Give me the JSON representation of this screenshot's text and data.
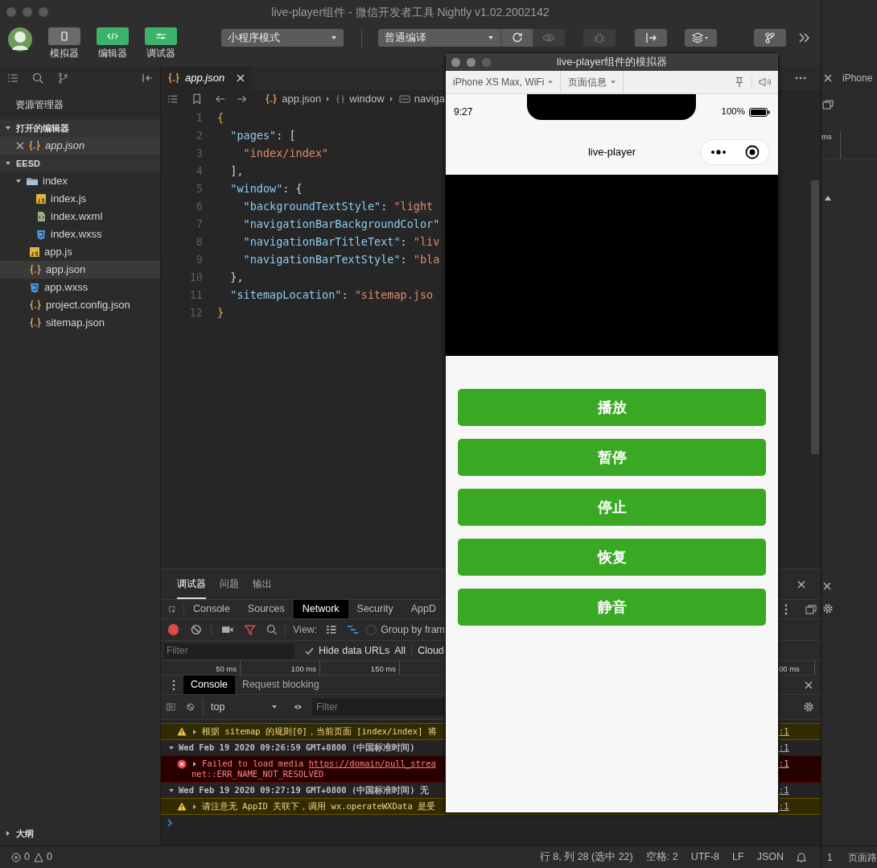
{
  "window": {
    "title": "live-player组件 - 微信开发者工具 Nightly v1.02.2002142"
  },
  "toolbar": {
    "view_toggles": [
      {
        "label": "模拟器",
        "on": false
      },
      {
        "label": "编辑器",
        "on": true
      },
      {
        "label": "调试器",
        "on": true
      }
    ],
    "mode": "小程序模式",
    "compile": "普通编译",
    "actions": [
      {
        "kind": "refresh",
        "disabled": false
      },
      {
        "kind": "preview",
        "disabled": true
      },
      {
        "kind": "debug",
        "disabled": true
      },
      {
        "kind": "background",
        "disabled": false
      },
      {
        "kind": "layers",
        "disabled": false
      },
      {
        "kind": "version",
        "disabled": false
      }
    ]
  },
  "sidebar": {
    "title": "资源管理器",
    "sections": [
      {
        "label": "打开的编辑器",
        "expanded": true,
        "items": [
          {
            "name": "app.json",
            "kind": "json",
            "selected": true,
            "closable": true
          }
        ]
      },
      {
        "label": "EESD",
        "expanded": true,
        "items": [
          {
            "name": "index",
            "kind": "folder",
            "selected": false,
            "expanded": true,
            "children": [
              {
                "name": "index.js",
                "kind": "js",
                "selected": false
              },
              {
                "name": "index.wxml",
                "kind": "wxml",
                "selected": false
              },
              {
                "name": "index.wxss",
                "kind": "wxss",
                "selected": false
              }
            ]
          },
          {
            "name": "app.js",
            "kind": "js",
            "selected": false
          },
          {
            "name": "app.json",
            "kind": "json",
            "selected": true
          },
          {
            "name": "app.wxss",
            "kind": "wxss",
            "selected": false
          },
          {
            "name": "project.config.json",
            "kind": "json",
            "selected": false
          },
          {
            "name": "sitemap.json",
            "kind": "json",
            "selected": false
          }
        ]
      },
      {
        "label": "大纲",
        "expanded": false
      }
    ]
  },
  "editor": {
    "tabs": [
      {
        "label": "app.json",
        "selected": true
      }
    ],
    "breadcrumb": [
      {
        "kind": "json",
        "label": "app.json"
      },
      {
        "kind": "object",
        "label": "window"
      },
      {
        "kind": "string",
        "label": "naviga"
      }
    ],
    "lines": [
      {
        "number": "1",
        "tokens": [
          {
            "kind": "brace",
            "text": "{"
          }
        ]
      },
      {
        "number": "2",
        "tokens": [
          {
            "kind": "key",
            "text": "  \"pages\""
          },
          {
            "kind": "punct",
            "text": ": ["
          }
        ]
      },
      {
        "number": "3",
        "tokens": [
          {
            "kind": "string",
            "text": "    \"index/index\""
          }
        ]
      },
      {
        "number": "4",
        "tokens": [
          {
            "kind": "punct",
            "text": "  ],"
          }
        ]
      },
      {
        "number": "5",
        "tokens": [
          {
            "kind": "key",
            "text": "  \"window\""
          },
          {
            "kind": "punct",
            "text": ": {"
          }
        ]
      },
      {
        "number": "6",
        "tokens": [
          {
            "kind": "key",
            "text": "    \"backgroundTextStyle\""
          },
          {
            "kind": "punct",
            "text": ": "
          },
          {
            "kind": "string",
            "text": "\"light"
          }
        ]
      },
      {
        "number": "7",
        "tokens": [
          {
            "kind": "key",
            "text": "    \"navigationBarBackgroundColor\""
          }
        ]
      },
      {
        "number": "8",
        "tokens": [
          {
            "kind": "key",
            "text": "    \"navigationBarTitleText\""
          },
          {
            "kind": "punct",
            "text": ": "
          },
          {
            "kind": "string",
            "text": "\"liv"
          }
        ]
      },
      {
        "number": "9",
        "tokens": [
          {
            "kind": "key",
            "text": "    \"navigationBarTextStyle\""
          },
          {
            "kind": "punct",
            "text": ": "
          },
          {
            "kind": "string",
            "text": "\"bla"
          }
        ]
      },
      {
        "number": "10",
        "tokens": [
          {
            "kind": "punct",
            "text": "  },"
          }
        ]
      },
      {
        "number": "11",
        "tokens": [
          {
            "kind": "key",
            "text": "  \"sitemapLocation\""
          },
          {
            "kind": "punct",
            "text": ": "
          },
          {
            "kind": "string",
            "text": "\"sitemap.jso"
          }
        ]
      },
      {
        "number": "12",
        "tokens": [
          {
            "kind": "brace",
            "text": "}"
          }
        ]
      }
    ]
  },
  "devtools": {
    "tabs": [
      {
        "label": "调试器",
        "selected": true
      },
      {
        "label": "问题",
        "selected": false
      },
      {
        "label": "输出",
        "selected": false
      }
    ],
    "panels": [
      {
        "label": "Console",
        "selected": false
      },
      {
        "label": "Sources",
        "selected": false
      },
      {
        "label": "Network",
        "selected": true
      },
      {
        "label": "Security",
        "selected": false
      },
      {
        "label": "AppD",
        "selected": false
      }
    ],
    "network": {
      "recording": true,
      "view_label": "View:",
      "group_by_frame": {
        "label": "Group by fram",
        "checked": false
      },
      "filter": {
        "placeholder": "Filter"
      },
      "hide_data_urls": {
        "label": "Hide data URLs",
        "checked": true
      },
      "types": [
        "All",
        "Cloud"
      ],
      "ticks": [
        "50 ms",
        "100 ms",
        "150 ms"
      ],
      "tick_right": "00 ms"
    },
    "drawer": {
      "tabs": [
        {
          "label": "Console",
          "selected": true
        },
        {
          "label": "Request blocking",
          "selected": false
        }
      ],
      "context": "top",
      "filter": {
        "placeholder": "Filter"
      },
      "messages": [
        {
          "kind": "warning",
          "text": "根据 sitemap 的规则[0]，当前页面 [index/index] 将",
          "source": ":1"
        },
        {
          "kind": "group",
          "text": "Wed Feb 19 2020 09:26:59 GMT+0800 (中国标准时间)",
          "source": ":1"
        },
        {
          "kind": "error",
          "text": "Failed to load media ",
          "link": "https://domain/pull_strea",
          "detail": "net::ERR_NAME_NOT_RESOLVED",
          "source": ":1"
        },
        {
          "kind": "group",
          "text": "Wed Feb 19 2020 09:27:19 GMT+0800 (中国标准时间) 无",
          "source": ":1"
        },
        {
          "kind": "warning",
          "text": "请注意无 AppID 关联下，调用 wx.operateWXData 是受",
          "source": ":1"
        }
      ]
    }
  },
  "simulator": {
    "title": "live-player组件的模拟器",
    "device": "iPhone XS Max, WiFi",
    "page_info": "页面信息",
    "phone": {
      "time": "9:27",
      "battery": "100%",
      "nav_title": "live-player",
      "buttons": [
        "播放",
        "暂停",
        "停止",
        "恢复",
        "静音"
      ]
    }
  },
  "status_bar": {
    "errors": "0",
    "warnings": "0",
    "items": [
      "行 8, 列 28 (选中 22)",
      "空格: 2",
      "UTF-8",
      "LF",
      "JSON"
    ]
  },
  "second_window": {
    "title": "iPhone",
    "timeline_tick": "ms",
    "status_count": "1",
    "status_label": "页面路"
  }
}
